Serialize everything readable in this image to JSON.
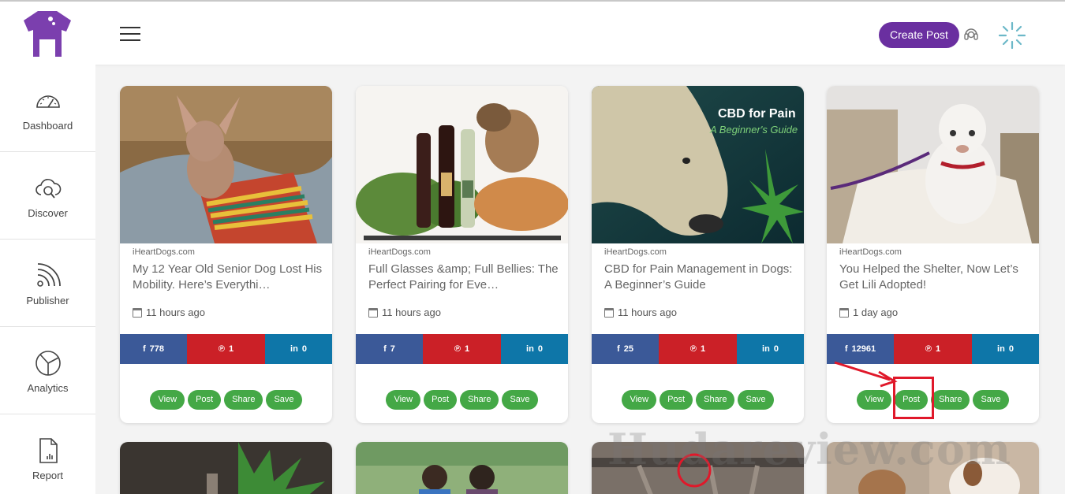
{
  "header": {
    "create_post_label": "Create Post"
  },
  "sidebar": {
    "items": [
      {
        "label": "Dashboard",
        "icon": "speedometer-icon"
      },
      {
        "label": "Discover",
        "icon": "cloud-search-icon"
      },
      {
        "label": "Publisher",
        "icon": "rss-icon"
      },
      {
        "label": "Analytics",
        "icon": "pie-chart-icon"
      },
      {
        "label": "Report",
        "icon": "report-document-icon"
      }
    ]
  },
  "cards": [
    {
      "source": "iHeartDogs.com",
      "title": "My 12 Year Old Senior Dog Lost His Mobility. Here’s Everythi…",
      "time": "11 hours ago",
      "facebook": "778",
      "pinterest": "1",
      "linkedin": "0"
    },
    {
      "source": "iHeartDogs.com",
      "title": "Full Glasses &amp; Full Bellies: The Perfect Pairing for Eve…",
      "time": "11 hours ago",
      "facebook": "7",
      "pinterest": "1",
      "linkedin": "0"
    },
    {
      "source": "iHeartDogs.com",
      "title": "CBD for Pain Management in Dogs: A Beginner’s Guide",
      "time": "11 hours ago",
      "facebook": "25",
      "pinterest": "1",
      "linkedin": "0",
      "thumb_text": "CBD for Pain",
      "thumb_subtext": "A Beginner's Guide"
    },
    {
      "source": "iHeartDogs.com",
      "title": "You Helped the Shelter, Now Let’s Get Lili Adopted!",
      "time": "1 day ago",
      "facebook": "12961",
      "pinterest": "1",
      "linkedin": "0"
    }
  ],
  "actions": {
    "view": "View",
    "post": "Post",
    "share": "Share",
    "save": "Save"
  },
  "watermark": "Hudareview.com",
  "colors": {
    "brand": "#6a2fa0",
    "facebook": "#3b5998",
    "pinterest": "#cb2027",
    "linkedin": "#0e76a8",
    "action_green": "#44a846",
    "highlight": "#e0182a"
  }
}
